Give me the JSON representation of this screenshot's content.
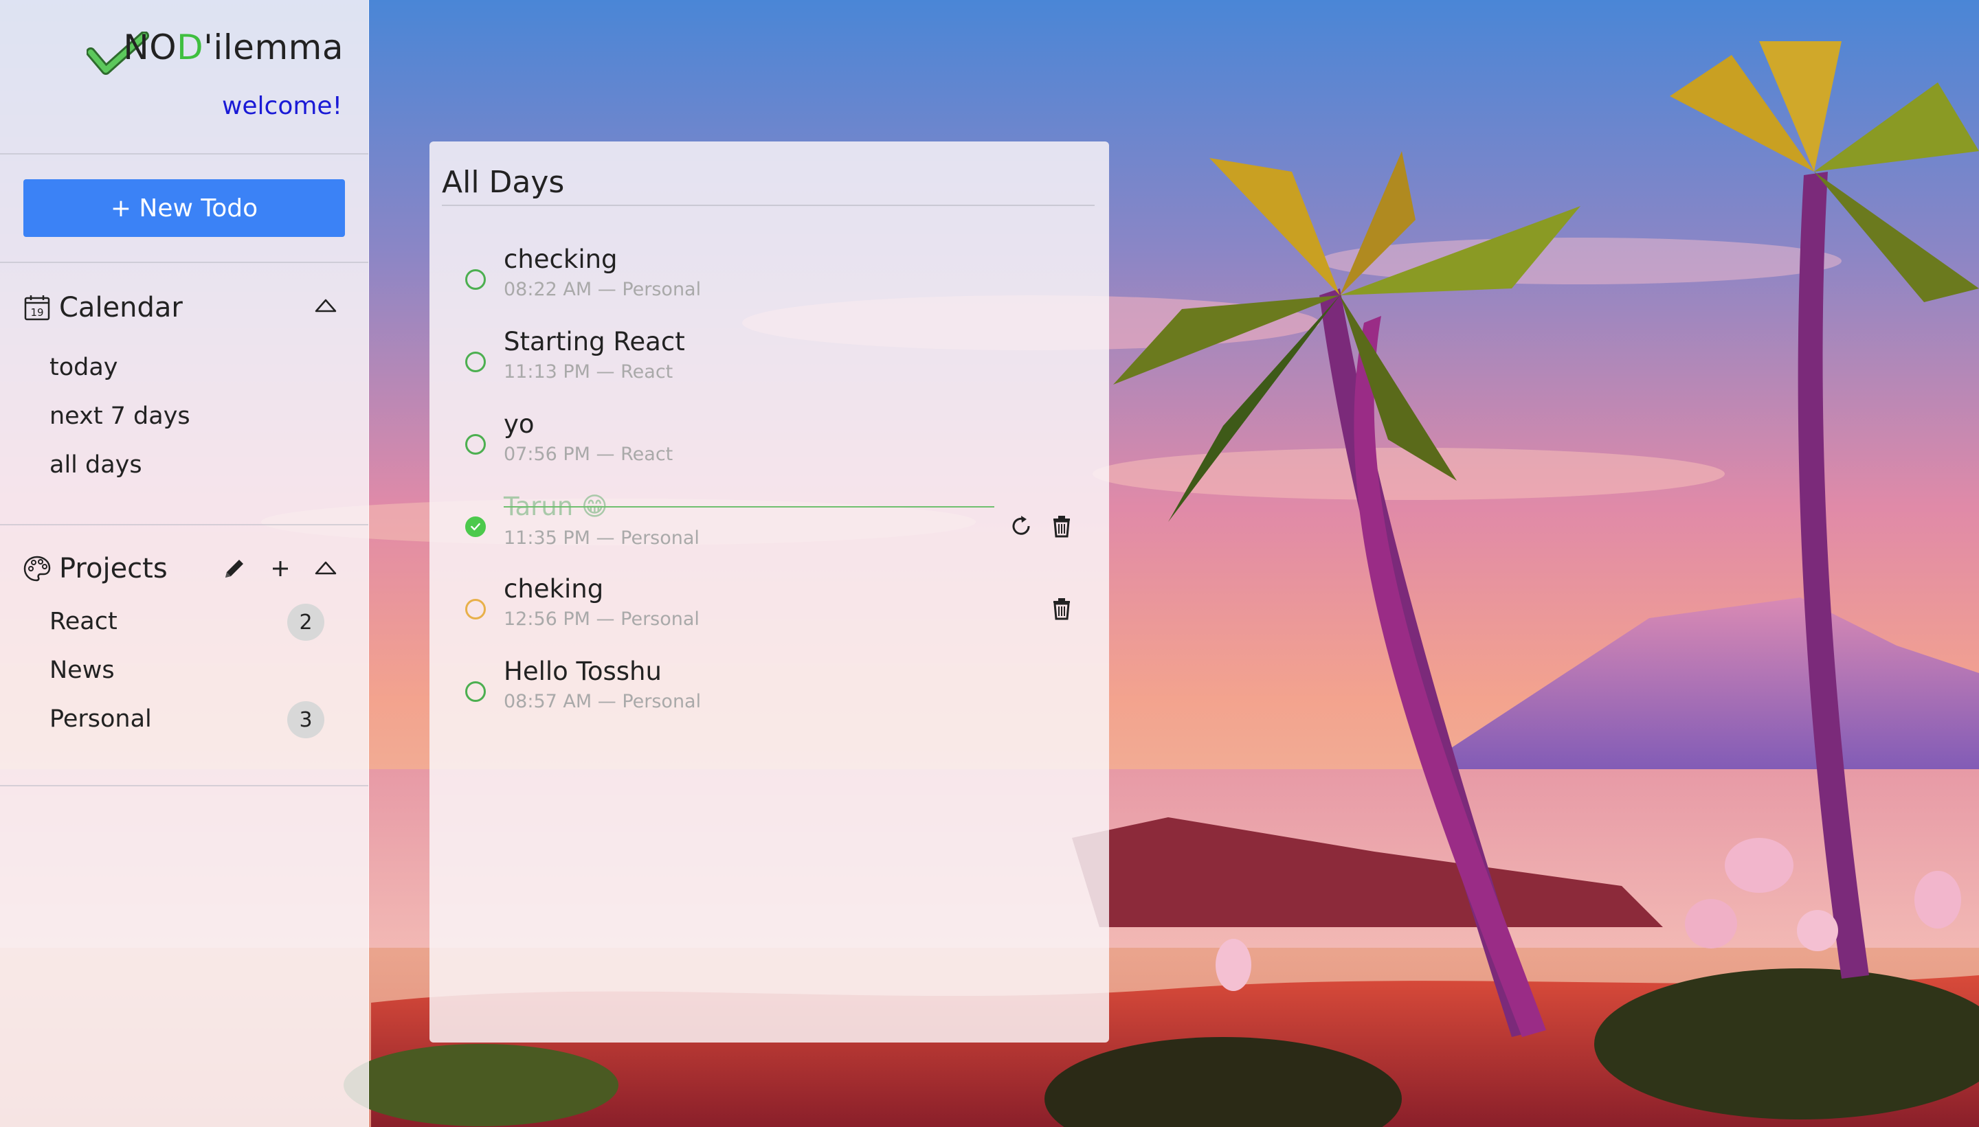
{
  "brand": {
    "name_pre": "NO",
    "name_d": "D",
    "name_post": "'ilemma",
    "welcome": "welcome!",
    "accent": "#3fbf3f"
  },
  "new_todo_label": "+ New Todo",
  "calendar": {
    "title": "Calendar",
    "icon_number": "19",
    "items": [
      "today",
      "next 7 days",
      "all days"
    ]
  },
  "projects": {
    "title": "Projects",
    "items": [
      {
        "label": "React",
        "count": "2"
      },
      {
        "label": "News",
        "count": ""
      },
      {
        "label": "Personal",
        "count": "3"
      }
    ]
  },
  "panel": {
    "title": "All Days",
    "todos": [
      {
        "title": "checking",
        "meta": "08:22 AM — Personal",
        "done": false
      },
      {
        "title": "Starting React",
        "meta": "11:13 PM — React",
        "done": false
      },
      {
        "title": "yo",
        "meta": "07:56 PM — React",
        "done": false
      },
      {
        "title": "Tarun 😁",
        "meta": "11:35 PM — Personal",
        "done": true
      },
      {
        "title": "cheking",
        "meta": "12:56 PM — Personal",
        "done": false
      },
      {
        "title": "Hello Tosshu",
        "meta": "08:57 AM — Personal",
        "done": false
      }
    ]
  },
  "colors": {
    "button": "#3b82f6",
    "check_green": "#4cc94c",
    "welcome": "#1a1ad6"
  }
}
